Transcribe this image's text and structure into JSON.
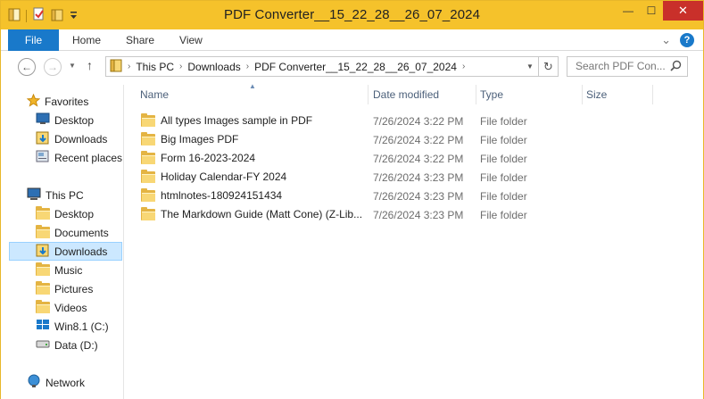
{
  "window": {
    "title": "PDF Converter__15_22_28__26_07_2024",
    "minimize": "—",
    "maximize": "☐",
    "close": "✕"
  },
  "ribbon": {
    "file_label": "File",
    "tabs": [
      "Home",
      "Share",
      "View"
    ],
    "expand": "⌄",
    "help": "?"
  },
  "address": {
    "back": "←",
    "forward": "→",
    "up": "↑",
    "crumbs": [
      "This PC",
      "Downloads",
      "PDF Converter__15_22_28__26_07_2024"
    ],
    "search_placeholder": "Search PDF Con...",
    "refresh": "↻"
  },
  "nav": {
    "favorites_label": "Favorites",
    "favorites": [
      "Desktop",
      "Downloads",
      "Recent places"
    ],
    "thispc_label": "This PC",
    "thispc": [
      "Desktop",
      "Documents",
      "Downloads",
      "Music",
      "Pictures",
      "Videos",
      "Win8.1 (C:)",
      "Data (D:)"
    ],
    "network_label": "Network"
  },
  "columns": {
    "name": "Name",
    "date": "Date modified",
    "type": "Type",
    "size": "Size"
  },
  "files": [
    {
      "name": "All types Images sample in PDF",
      "date": "7/26/2024 3:22 PM",
      "type": "File folder"
    },
    {
      "name": "Big Images PDF",
      "date": "7/26/2024 3:22 PM",
      "type": "File folder"
    },
    {
      "name": "Form 16-2023-2024",
      "date": "7/26/2024 3:22 PM",
      "type": "File folder"
    },
    {
      "name": "Holiday Calendar-FY 2024",
      "date": "7/26/2024 3:23 PM",
      "type": "File folder"
    },
    {
      "name": "htmlnotes-180924151434",
      "date": "7/26/2024 3:23 PM",
      "type": "File folder"
    },
    {
      "name": "The Markdown Guide (Matt Cone) (Z-Lib...",
      "date": "7/26/2024 3:23 PM",
      "type": "File folder"
    }
  ]
}
